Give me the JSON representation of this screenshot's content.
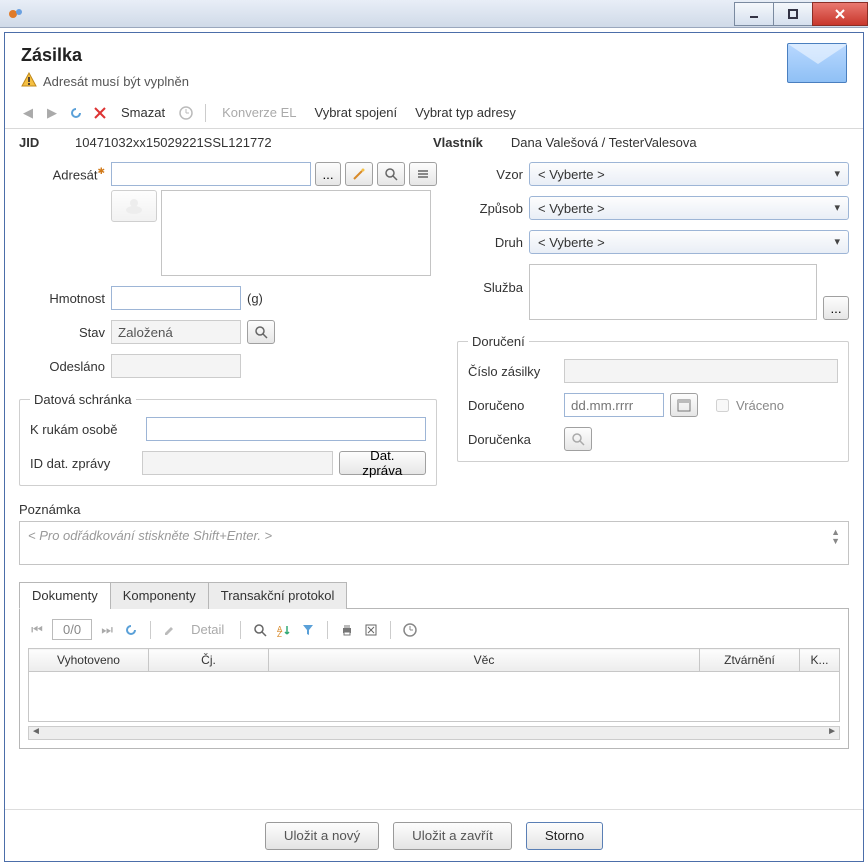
{
  "window": {
    "title": ""
  },
  "header": {
    "title": "Zásilka",
    "warning": "Adresát musí být vyplněn"
  },
  "toolbar": {
    "smazat": "Smazat",
    "konverze": "Konverze EL",
    "vybrat_spojeni": "Vybrat spojení",
    "vybrat_typ_adresy": "Vybrat typ adresy"
  },
  "jid": {
    "label": "JID",
    "value": "10471032xx15029221SSL121772"
  },
  "owner": {
    "label": "Vlastník",
    "value": "Dana Valešová / TesterValesova"
  },
  "left": {
    "adresat_label": "Adresát",
    "adresat_value": "",
    "hmotnost_label": "Hmotnost",
    "hmotnost_unit": "(g)",
    "stav_label": "Stav",
    "stav_value": "Založená",
    "odeslano_label": "Odesláno",
    "ds_group": "Datová schránka",
    "k_rukam_label": "K rukám osobě",
    "id_dat_label": "ID dat. zprávy",
    "dat_zprava_btn": "Dat. zpráva"
  },
  "right": {
    "vzor_label": "Vzor",
    "vzor_value": "< Vyberte >",
    "zpusob_label": "Způsob",
    "zpusob_value": "< Vyberte >",
    "druh_label": "Druh",
    "druh_value": "< Vyberte >",
    "sluzba_label": "Služba",
    "doruceni_group": "Doručení",
    "cislo_label": "Číslo zásilky",
    "doruceno_label": "Doručeno",
    "doruceno_ph": "dd.mm.rrrr",
    "vraceno_label": "Vráceno",
    "dorucenka_label": "Doručenka"
  },
  "note": {
    "label": "Poznámka",
    "placeholder": "< Pro odřádkování stiskněte Shift+Enter. >"
  },
  "tabs": {
    "dokumenty": "Dokumenty",
    "komponenty": "Komponenty",
    "transakcni": "Transakční protokol"
  },
  "grid": {
    "pager": "0/0",
    "detail": "Detail",
    "columns": {
      "vyhotoveno": "Vyhotoveno",
      "cj": "Čj.",
      "vec": "Věc",
      "ztvarneni": "Ztvárnění",
      "k": "K..."
    }
  },
  "footer": {
    "ulozit_novy": "Uložit a nový",
    "ulozit_zavrit": "Uložit a zavřít",
    "storno": "Storno"
  }
}
